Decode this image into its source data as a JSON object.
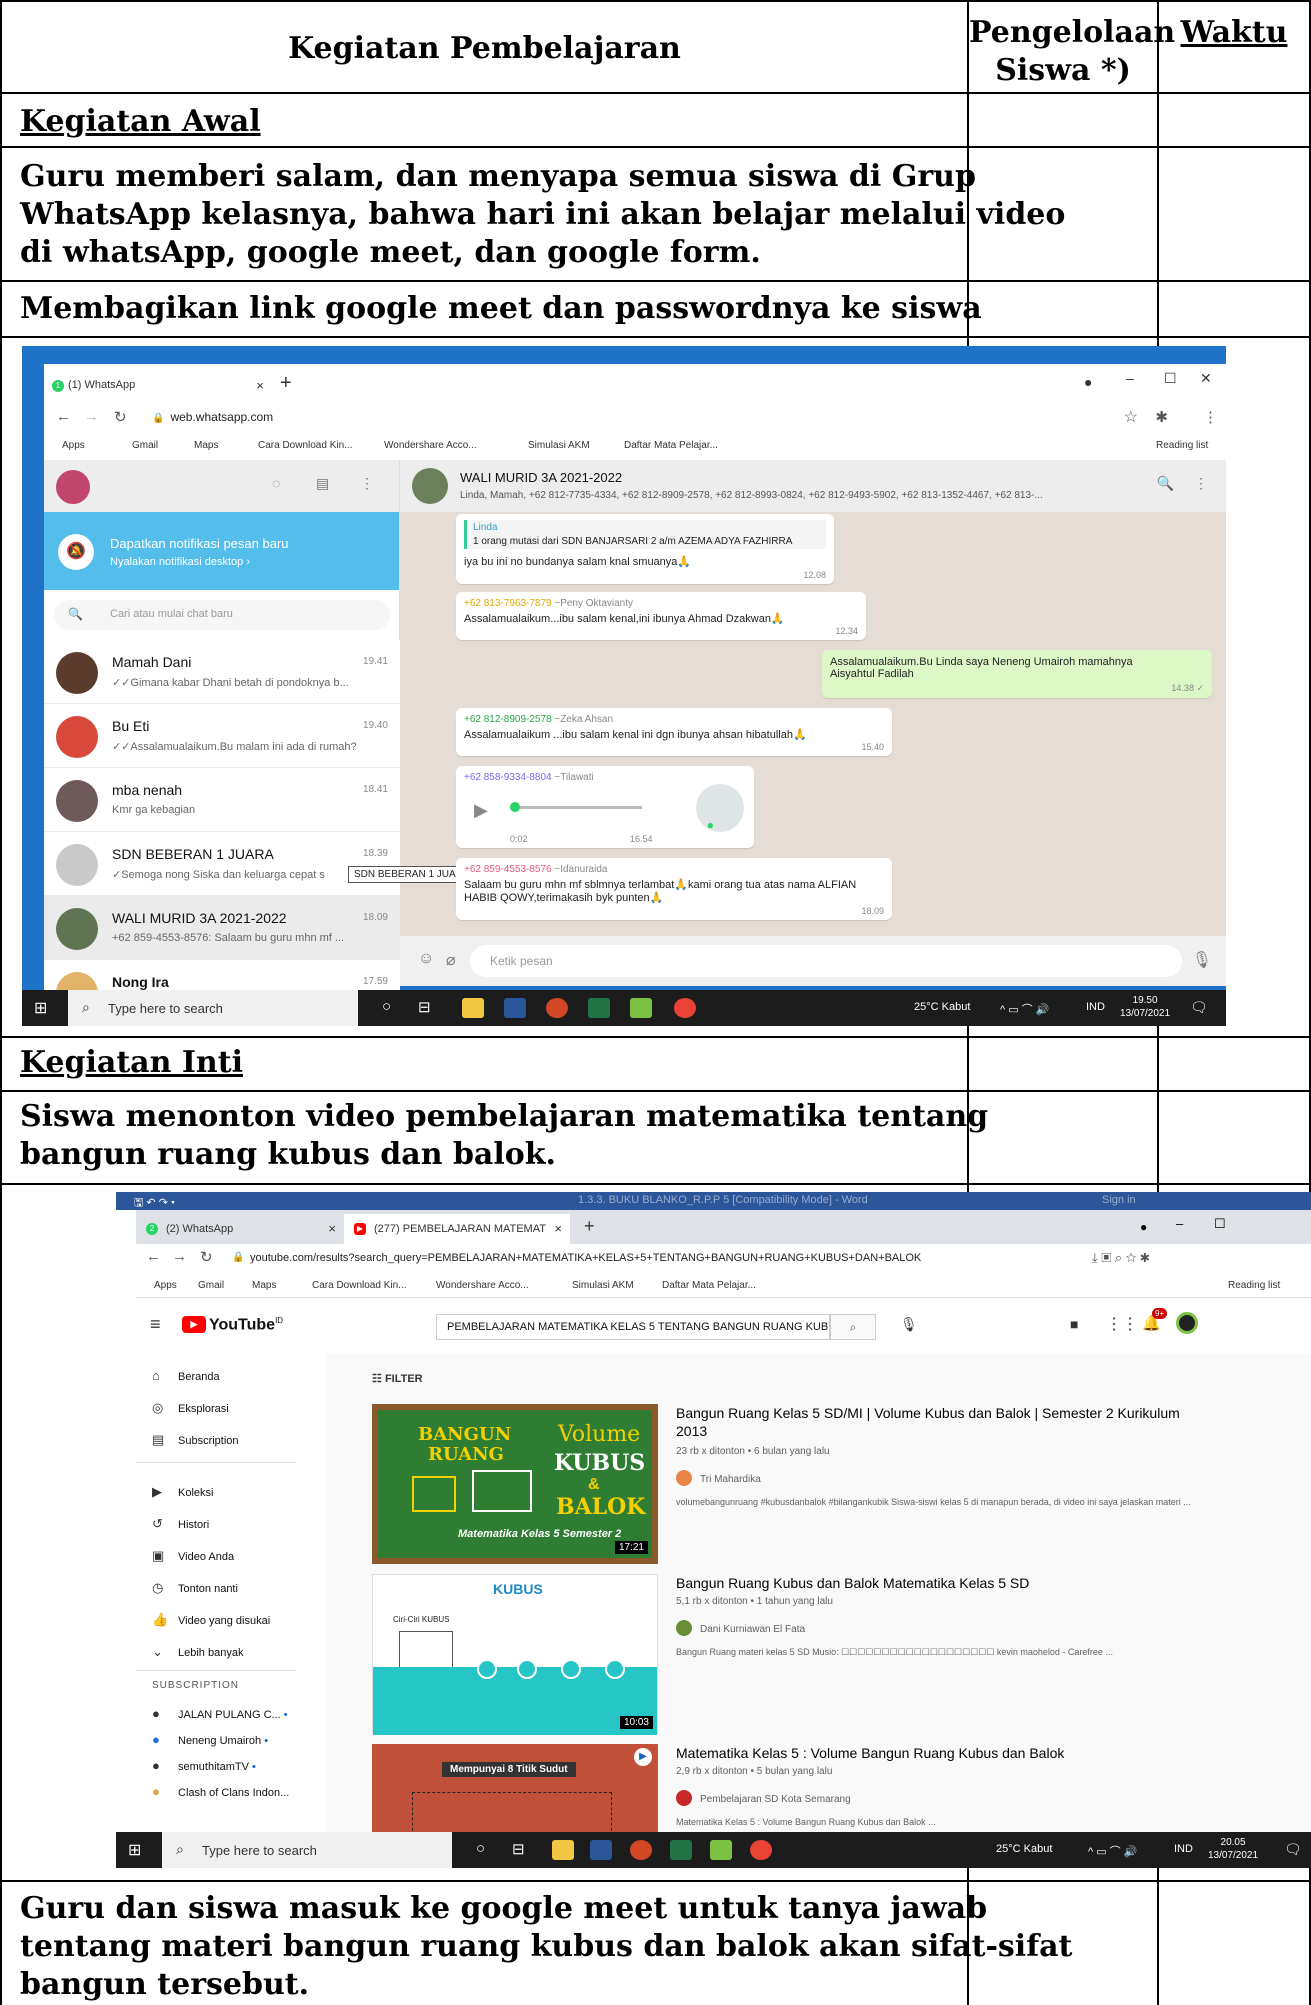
{
  "table": {
    "header": {
      "col1": "Kegiatan Pembelajaran",
      "col2_line1": "Pengelolaan",
      "col2_line2": "Siswa *)",
      "col3": "Waktu"
    },
    "section_awal": "Kegiatan Awal",
    "row_salam": [
      "Guru memberi salam, dan menyapa semua siswa di Grup",
      "WhatsApp kelasnya, bahwa hari ini akan belajar melalui video",
      "di whatsApp,  google meet, dan google form."
    ],
    "row_link": "Membagikan link google meet dan passwordnya ke siswa",
    "section_inti": "Kegiatan Inti",
    "row_video": [
      "Siswa menonton video pembelajaran matematika tentang",
      "bangun ruang kubus dan balok."
    ],
    "row_meet": [
      "Guru dan siswa masuk ke google meet untuk tanya jawab",
      "tentang materi bangun ruang kubus dan balok akan sifat-sifat",
      "bangun tersebut."
    ]
  },
  "whatsapp_shot": {
    "tab_label": "(1) WhatsApp",
    "tab_badge": "1",
    "url": "web.whatsapp.com",
    "bookmarks": [
      "Apps",
      "Gmail",
      "Maps",
      "Cara Download Kin...",
      "Wondershare Acco...",
      "Simulasi AKM",
      "Daftar Mata Pelajar...",
      "Reading list"
    ],
    "notif_title": "Dapatkan notifikasi pesan baru",
    "notif_sub": "Nyalakan notifikasi desktop ›",
    "search_placeholder": "Cari atau mulai chat baru",
    "chats": [
      {
        "name": "Mamah Dani",
        "time": "19.41",
        "preview": "✓✓Gimana kabar Dhani betah di pondoknya b..."
      },
      {
        "name": "Bu Eti",
        "time": "19.40",
        "preview": "✓✓Assalamualaikum.Bu malam ini ada di rumah?"
      },
      {
        "name": "mba nenah",
        "time": "18.41",
        "preview": "Kmr ga kebagian"
      },
      {
        "name": "SDN BEBERAN 1 JUARA",
        "time": "18.39",
        "preview": "✓Semoga nong Siska dan keluarga cepat s"
      },
      {
        "name": "WALI MURID 3A 2021-2022",
        "time": "18.09",
        "preview": "+62 859-4553-8576: Salaam bu guru mhn mf ..."
      },
      {
        "name": "Nong Ira",
        "time": "17.59",
        "preview": ""
      }
    ],
    "tooltip": "SDN BEBERAN 1 JUARA",
    "group_name": "WALI MURID 3A 2021-2022",
    "group_members": "Linda, Mamah, +62 812-7735-4334, +62 812-8909-2578, +62 812-8993-0824, +62 812-9493-5902, +62 813-1352-4467, +62 813-...",
    "messages": [
      {
        "sender": "Linda",
        "quote": "1 orang mutasi dari  SDN BANJARSARI 2 a/m AZEMA ADYA FAZHIRRA",
        "text": "iya bu ini no bundanya salam knal smuanya🙏",
        "time": "12.08"
      },
      {
        "sender": "+62 813-7963-7879",
        "alias": "~Peny Oktavianty",
        "text": "Assalamualaikum...ibu salam kenal,ini ibunya Ahmad Dzakwan🙏",
        "time": "12.34"
      },
      {
        "text": "Assalamualaikum.Bu Linda saya  Neneng Umairoh mamahnya Aisyahtul Fadilah",
        "time": "14.38 ✓"
      },
      {
        "sender": "+62 812-8909-2578",
        "alias": "~Zeka Ahsan",
        "text": "Assalamualaikum ...ibu salam kenal ini dgn ibunya ahsan hibatullah🙏",
        "time": "15.40"
      },
      {
        "sender": "+62 858-9334-8804",
        "alias": "~Tilawati",
        "audio_pos": "0:02",
        "audio_len": "16.54"
      },
      {
        "sender": "+62 859-4553-8576",
        "alias": "~Idanuraida",
        "text": "Salaam bu guru mhn mf sblmnya terlambat🙏kami orang tua atas nama ALFIAN HABIB QOWY,terimakasih byk punten🙏",
        "time": "18.09"
      }
    ],
    "input_placeholder": "Ketik pesan",
    "taskbar": {
      "search": "Type here to search",
      "weather": "25°C  Kabut",
      "lang": "IND",
      "time": "19.50",
      "date": "13/07/2021"
    }
  },
  "youtube_shot": {
    "word_title": "1.3.3. BUKU BLANKO_R.P.P 5 [Compatibility Mode] - Word",
    "word_signin": "Sign in",
    "tabs": [
      "(2) WhatsApp",
      "(277) PEMBELAJARAN MATEMAT"
    ],
    "url": "youtube.com/results?search_query=PEMBELAJARAN+MATEMATIKA+KELAS+5+TENTANG+BANGUN+RUANG+KUBUS+DAN+BALOK",
    "bookmarks": [
      "Apps",
      "Gmail",
      "Maps",
      "Cara Download Kin...",
      "Wondershare Acco...",
      "Simulasi AKM",
      "Daftar Mata Pelajar...",
      "Reading list"
    ],
    "logo": "YouTube",
    "logo_region": "ID",
    "search_value": "PEMBELAJARAN MATEMATIKA KELAS 5 TENTANG BANGUN RUANG KUBUS DAN",
    "notif_count": "9+",
    "sidebar": [
      "Beranda",
      "Eksplorasi",
      "Subscription",
      "Koleksi",
      "Histori",
      "Video Anda",
      "Tonton nanti",
      "Video yang disukai",
      "Lebih banyak"
    ],
    "subs_header": "SUBSCRIPTION",
    "subs": [
      "JALAN PULANG C...",
      "Neneng Umairoh",
      "semuthitamTV",
      "Clash of Clans Indon..."
    ],
    "filter": "FILTER",
    "videos": [
      {
        "title": "Bangun Ruang Kelas 5 SD/MI | Volume Kubus dan Balok | Semester 2 Kurikulum 2013",
        "meta": "23 rb x ditonton • 6 bulan yang lalu",
        "channel": "Tri Mahardika",
        "desc": "volumebangunruang #kubusdanbalok #bilangankubik Siswa-siswi kelas 5 di manapun berada, di video ini saya jelaskan materi ...",
        "duration": "17:21",
        "thumb_words": [
          "BANGUN",
          "RUANG",
          "Volume",
          "KUBUS",
          "&",
          "BALOK",
          "Matematika Kelas 5 Semester 2"
        ]
      },
      {
        "title": "Bangun Ruang Kubus dan Balok Matematika Kelas 5 SD",
        "meta": "5,1 rb x ditonton • 1 tahun yang lalu",
        "channel": "Dani Kurniawan El Fata",
        "desc": "Bangun Ruang materi kelas 5 SD Musio: ☐☐☐☐☐☐☐☐☐☐☐☐☐☐☐☐☐☐☐ kevin maohelod - Carefree ...",
        "duration": "10:03",
        "thumb_words": [
          "KUBUS",
          "Ciri-Ciri KUBUS"
        ]
      },
      {
        "title": "Matematika Kelas 5 : Volume Bangun Ruang Kubus dan Balok",
        "meta": "2,9 rb x ditonton • 5 bulan yang lalu",
        "channel": "Pembelajaran SD Kota Semarang",
        "desc": "Matematika Kelas 5 : Volume Bangun Ruang Kubus dan Balok ...",
        "thumb_words": [
          "Mempunyai 8 Titik Sudut"
        ]
      }
    ],
    "taskbar": {
      "search": "Type here to search",
      "weather": "25°C  Kabut",
      "lang": "IND",
      "time": "20.05",
      "date": "13/07/2021"
    }
  },
  "colors": {
    "whatsapp_green": "#25d366",
    "notif_blue": "#53bdeb",
    "youtube_red": "#ff0000",
    "word_blue": "#2b579a",
    "desktop_blue": "#1e73c8"
  }
}
